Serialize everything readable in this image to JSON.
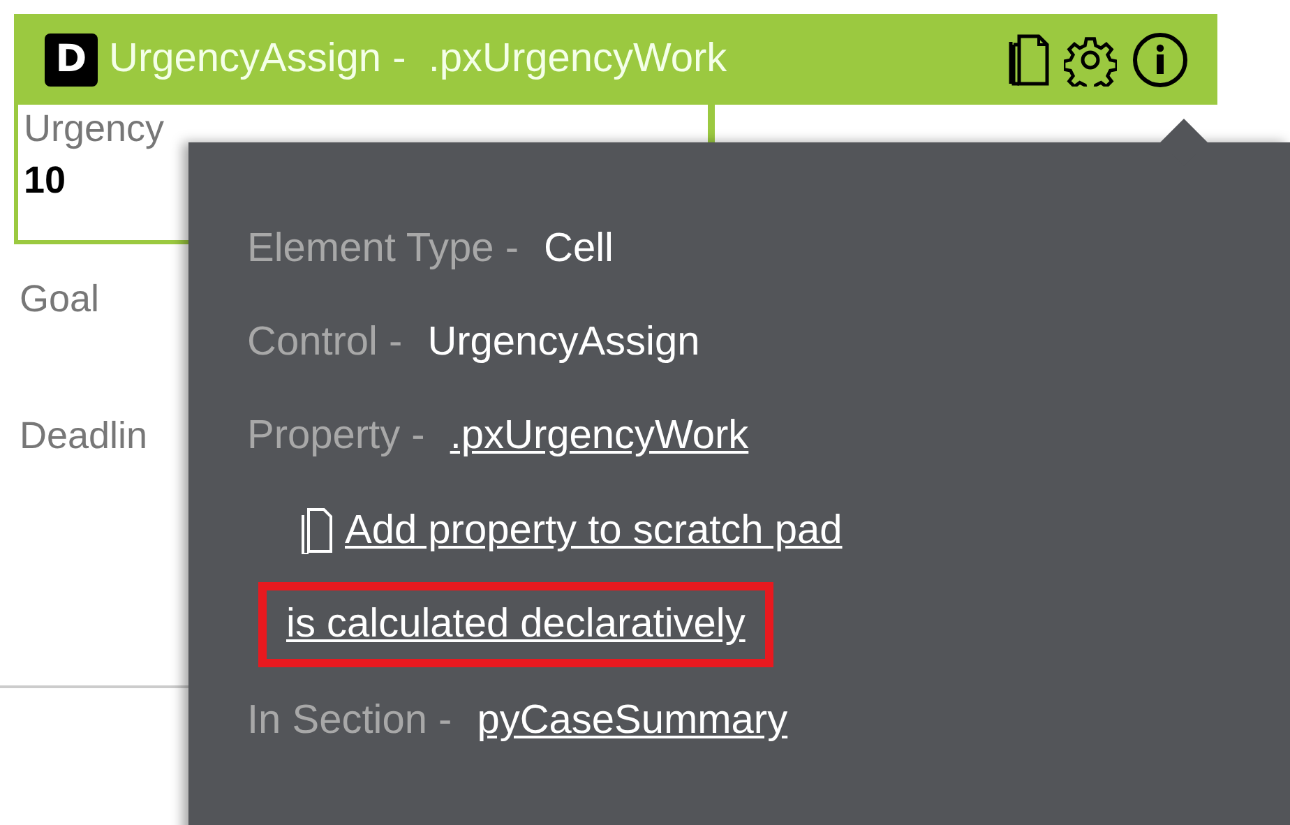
{
  "header": {
    "badge": "D",
    "title": "UrgencyAssign -  .pxUrgencyWork"
  },
  "fields": [
    {
      "label": "Urgency",
      "value": "10",
      "selected": true
    },
    {
      "label": "Goal",
      "selected": false
    },
    {
      "label": "Deadlin",
      "selected": false
    }
  ],
  "popover": {
    "rows": [
      {
        "kind": "pair",
        "label": "Element Type -",
        "value": "Cell"
      },
      {
        "kind": "pair",
        "label": "Control -",
        "value": "UrgencyAssign"
      },
      {
        "kind": "link-pair",
        "label": "Property -",
        "value": ".pxUrgencyWork"
      },
      {
        "kind": "action",
        "text": "Add property to scratch pad"
      },
      {
        "kind": "highlighted-link",
        "text": "is calculated declaratively"
      },
      {
        "kind": "link-pair",
        "label": "In Section -",
        "value": "pyCaseSummary"
      }
    ]
  }
}
